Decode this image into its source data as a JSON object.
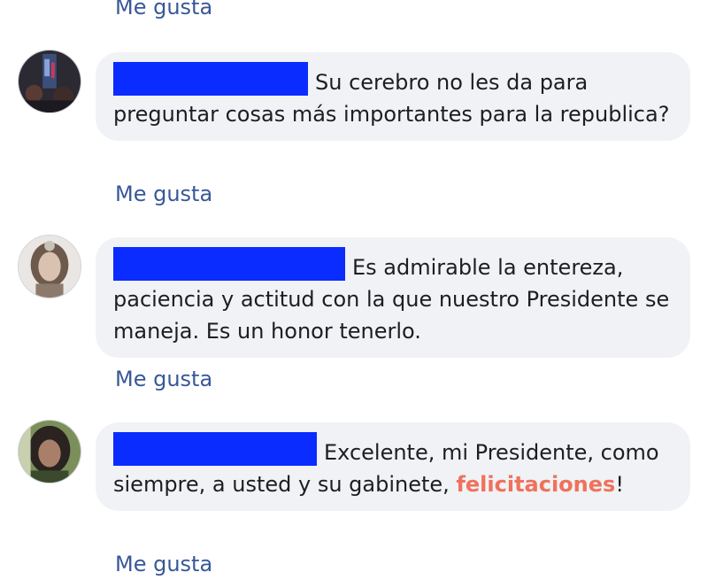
{
  "top_like_label": "Me gusta",
  "comments": [
    {
      "text": "Su cerebro no les da para preguntar cosas más importantes para la republica?",
      "like_label": "Me gusta"
    },
    {
      "text": "Es admirable la entereza, paciencia y actitud con la que nuestro Presidente se maneja. Es un honor tenerlo.",
      "like_label": "Me gusta"
    },
    {
      "text_before": "Excelente, mi Presidente, como siempre, a usted y su gabinete, ",
      "highlight": "felicitaciones",
      "text_after": "!",
      "like_label": "Me gusta"
    }
  ],
  "colors": {
    "like_link": "#385898",
    "bubble_bg": "#f0f2f5",
    "redaction": "#0a2cff",
    "highlight": "#f0715b"
  }
}
